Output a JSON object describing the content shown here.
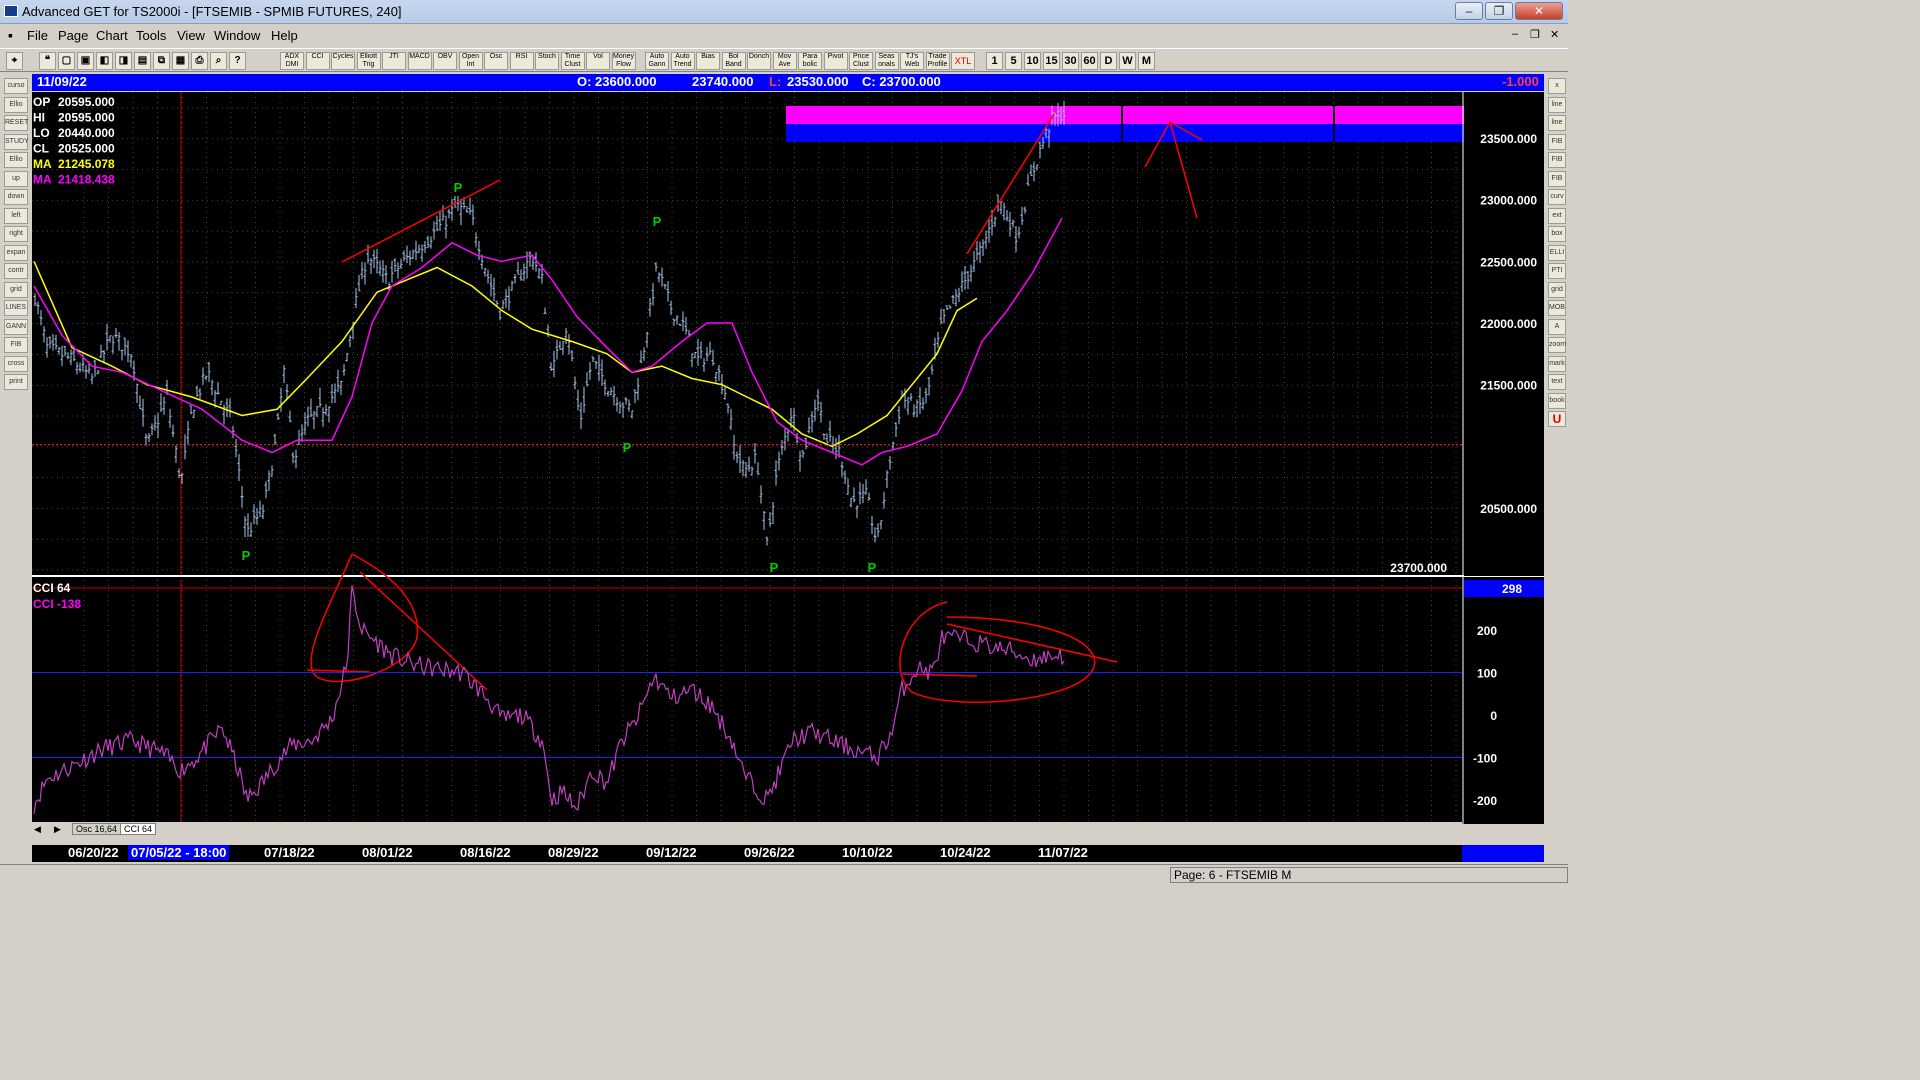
{
  "window": {
    "title": "Advanced GET for TS2000i - [FTSEMIB - SPMIB FUTURES, 240]",
    "controls": [
      "–",
      "❐",
      "✕"
    ],
    "inner_controls": [
      "–",
      "❐",
      "✕"
    ]
  },
  "menu": [
    "File",
    "Page",
    "Chart",
    "Tools",
    "View",
    "Window",
    "Help"
  ],
  "toolbar": {
    "indicators": [
      "ADX DMI",
      "CCI",
      "Cycles",
      "Elliott Trig",
      "JTI",
      "MACD",
      "OBV",
      "Open Int",
      "Osc",
      "RSI",
      "Stoch",
      "Time Clust",
      "Vol",
      "Money Flow",
      "Auto Gann",
      "Auto Trend",
      "Bias",
      "Bol Band",
      "Donch",
      "Mov Ave",
      "Para bolic",
      "Pivot",
      "Price Clust",
      "Seas onals",
      "TJ's Web",
      "Trade Profile",
      "XTL"
    ],
    "intervals": [
      "1",
      "5",
      "10",
      "15",
      "30",
      "60",
      "D",
      "W",
      "M"
    ]
  },
  "left_tools": [
    "cursor",
    "Elliott",
    "RESET",
    "STUDY",
    "Elliott",
    "up",
    "down",
    "left",
    "right",
    "expand",
    "contract",
    "grid",
    "LINES",
    "GANN",
    "FIB",
    "cross",
    "print"
  ],
  "right_tools": [
    "x",
    "line",
    "line",
    "FIB RET",
    "FIB EXT",
    "FIB TIME",
    "curve",
    "ext",
    "box",
    "ELLIPSE",
    "PTI",
    "grid",
    "MOB",
    "A",
    "zoom",
    "marker",
    "text",
    "book",
    "U"
  ],
  "info_bar": {
    "date": "11/09/22",
    "open": "O: 23600.000",
    "high": "23740.000",
    "low_label": "L:",
    "low": "23530.000",
    "close": "C: 23700.000",
    "change": "-1.000"
  },
  "price_panel": {
    "stats": [
      {
        "label": "OP",
        "value": "20595.000",
        "color": "#ffffff"
      },
      {
        "label": "HI",
        "value": "20595.000",
        "color": "#ffffff"
      },
      {
        "label": "LO",
        "value": "20440.000",
        "color": "#ffffff"
      },
      {
        "label": "CL",
        "value": "20525.000",
        "color": "#ffffff"
      },
      {
        "label": "MA",
        "value": "21245.078",
        "color": "#ffff00"
      },
      {
        "label": "MA",
        "value": "21418.438",
        "color": "#ff00ff"
      }
    ],
    "y_ticks": [
      "23500.000",
      "23000.000",
      "22500.000",
      "22000.000",
      "21500.000",
      "20500.000"
    ],
    "y_tick_values": [
      23500,
      23000,
      22500,
      22000,
      21500,
      20500
    ],
    "ref_line_label": "21012.353",
    "ref_line_value": 21012.353,
    "last_price": "23700.000",
    "pivot_label": "P",
    "bar_color": "#a8c8f0"
  },
  "cci_panel": {
    "title": "CCI 64",
    "current": "CCI  -138",
    "top_label": "298",
    "y_ticks": [
      "200",
      "100",
      "0",
      "-100",
      "-200"
    ],
    "y_tick_values": [
      200,
      100,
      0,
      -100,
      -200
    ]
  },
  "tabs": [
    "Osc 16,64",
    "CCI 64"
  ],
  "dates": [
    "06/20/22",
    "07/05/22 - 18:00",
    "07/18/22",
    "08/01/22",
    "08/16/22",
    "08/29/22",
    "09/12/22",
    "09/26/22",
    "10/10/22",
    "10/24/22",
    "11/07/22"
  ],
  "status": "Page: 6 - FTSEMIB M",
  "colors": {
    "ma_fast": "#ffff00",
    "ma_slow": "#ff00ff",
    "pivot": "#00cc00",
    "annotation": "#ff0000",
    "band_magenta": "#ff00ff",
    "band_blue": "#0000ff",
    "cci_line": "#c040c0"
  }
}
